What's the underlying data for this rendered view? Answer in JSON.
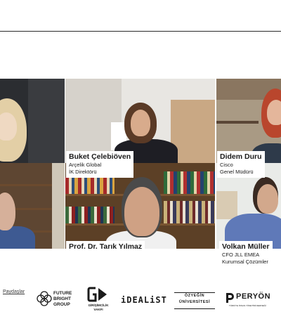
{
  "participants": [
    {
      "name": "",
      "org": "",
      "role": ""
    },
    {
      "name": "Buket Çelebiöven",
      "org": "Arçelik Global",
      "role": "İK Direktörü"
    },
    {
      "name": "Didem Duru",
      "org": "Cisco",
      "role": "Genel Müdürü"
    },
    {
      "name": "",
      "org": "",
      "role": ""
    },
    {
      "name": "Prof. Dr. Tarık Yılmaz",
      "org": "",
      "role": ""
    },
    {
      "name": "Volkan Müller",
      "org": "CFO JLL EMEA",
      "role": "Kurumsal Çözümler"
    }
  ],
  "footer": {
    "stakeholders_label": "Paydaşlar",
    "logos": [
      {
        "icon": "future-bright-group-logo",
        "lines": [
          "FUTURE",
          "BRIGHT",
          "GROUP"
        ]
      },
      {
        "icon": "girisimcilik-vakfi-logo",
        "lines": [
          "GİRİŞİMCİLİK",
          "VAKFI"
        ]
      },
      {
        "icon": "idealist-logo",
        "lines": [
          "iDEALiST"
        ]
      },
      {
        "icon": "ozyegin-universitesi-logo",
        "lines": [
          "ÖZYEĞİN",
          "ÜNİVERSİTESİ"
        ]
      },
      {
        "icon": "peryon-logo",
        "lines": [
          "PERYÖN",
          "TÜRKİYE İNSAN YÖNETİMİ DERNEĞİ"
        ]
      }
    ]
  }
}
